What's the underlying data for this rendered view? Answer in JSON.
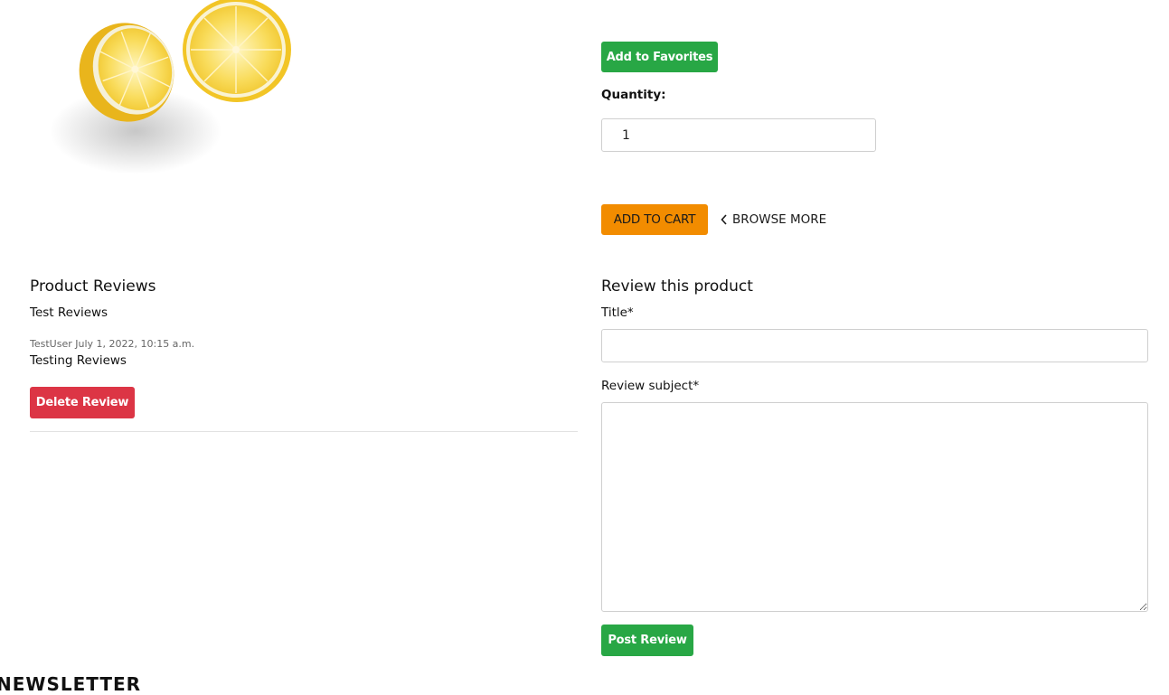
{
  "product": {
    "image_name": "lemon-halves-image",
    "favorites_label": "Add to Favorites",
    "quantity_label": "Quantity:",
    "quantity_value": "1",
    "add_to_cart_label": "ADD TO CART",
    "browse_more_label": "BROWSE MORE"
  },
  "reviews": {
    "heading": "Product Reviews",
    "section_title": "Test Reviews",
    "items": [
      {
        "meta": "TestUser July 1, 2022, 10:15 a.m.",
        "text": "Testing Reviews",
        "delete_label": "Delete Review"
      }
    ]
  },
  "review_form": {
    "heading": "Review this product",
    "title_label": "Title*",
    "title_value": "",
    "subject_label": "Review subject*",
    "subject_value": "",
    "submit_label": "Post Review"
  },
  "footer": {
    "newsletter_heading": "NEWSLETTER"
  },
  "colors": {
    "green": "#28a745",
    "red": "#dc3545",
    "orange": "#f28c00"
  }
}
